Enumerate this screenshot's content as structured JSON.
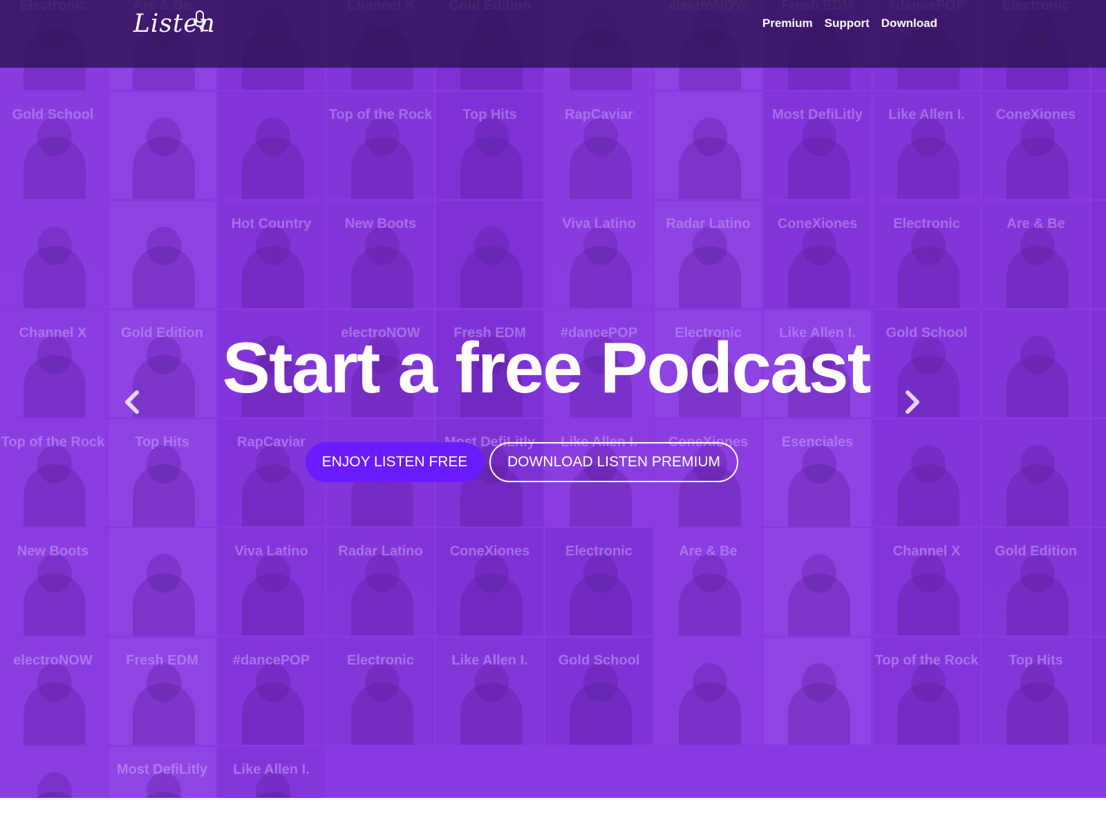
{
  "brand": {
    "logo_text": "Listen"
  },
  "nav": {
    "links": [
      "Premium",
      "Support",
      "Download"
    ]
  },
  "hero": {
    "headline": "Start a free Podcast",
    "cta_free_label": "ENJOY LISTEN FREE",
    "cta_premium_label": "DOWNLOAD LISTEN PREMIUM"
  },
  "playlist_tiles": [
    [
      "Electronic",
      "Are & Be",
      "",
      "Channel X",
      "Gold Edition",
      "",
      "electroNOW",
      "Fresh EDM",
      "#dancePOP",
      "Electronic"
    ],
    [
      "Like Allen I.",
      "Gold School",
      "",
      "",
      "Top of the Rock",
      "Top Hits",
      "RapCaviar",
      "",
      "Most DefiLitly",
      "Like Allen I."
    ],
    [
      "ConeXiones",
      "Esenciales",
      "",
      "",
      "Hot Country",
      "New Boots",
      "",
      "Viva Latino",
      "Radar Latino",
      "ConeXiones"
    ],
    [
      "Electronic",
      "Are & Be",
      "",
      "Channel X",
      "Gold Edition",
      "",
      "electroNOW",
      "Fresh EDM",
      "#dancePOP",
      "Electronic"
    ],
    [
      "Like Allen I.",
      "Gold School",
      "",
      "",
      "Top of the Rock",
      "Top Hits",
      "RapCaviar",
      "",
      "Most DefiLitly",
      "Like Allen I."
    ],
    [
      "ConeXiones",
      "Esenciales",
      "",
      "",
      "Hot Country",
      "New Boots",
      "",
      "Viva Latino",
      "Radar Latino",
      "ConeXiones"
    ],
    [
      "Electronic",
      "Are & Be",
      "",
      "Channel X",
      "Gold Edition",
      "",
      "electroNOW",
      "Fresh EDM",
      "#dancePOP",
      "Electronic"
    ],
    [
      "Like Allen I.",
      "Gold School",
      "",
      "",
      "Top of the Rock",
      "Top Hits",
      "RapCaviar",
      "",
      "Most DefiLitly",
      "Like Allen I."
    ]
  ],
  "icons": {
    "prev": "chevron-left-icon",
    "next": "chevron-right-icon",
    "logo_mic": "microphone-icon"
  },
  "colors": {
    "hero_purple": "#8a3bde",
    "navbar": "#301252",
    "cta_free": "#6a1cff",
    "text": "#ffffff"
  }
}
